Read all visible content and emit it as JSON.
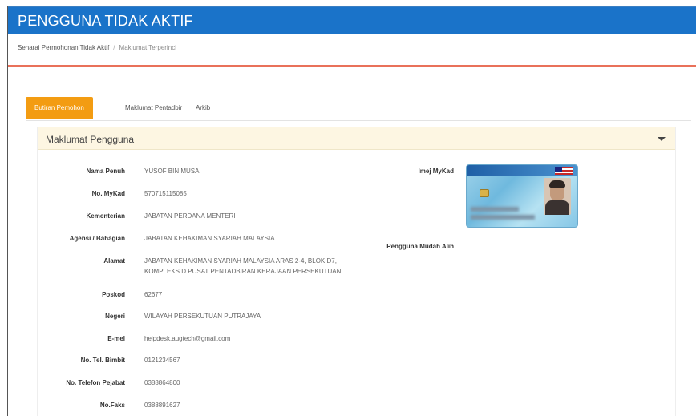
{
  "page": {
    "title": "PENGGUNA TIDAK AKTIF"
  },
  "breadcrumb": {
    "items": [
      "Senarai Permohonan Tidak Aktif",
      "Maklumat Terperinci"
    ],
    "separator": "/"
  },
  "tabs": [
    {
      "label": "Butiran Pemohon",
      "active": true
    },
    {
      "label": "Maklumat Pentadbir",
      "active": false
    },
    {
      "label": "Arkib",
      "active": false
    }
  ],
  "panel": {
    "title": "Maklumat Pengguna",
    "toggle_icon": "caret-down-icon"
  },
  "fields": [
    {
      "label": "Nama Penuh",
      "value": "YUSOF BIN MUSA"
    },
    {
      "label": "No. MyKad",
      "value": "570715115085"
    },
    {
      "label": "Kementerian",
      "value": "JABATAN PERDANA MENTERI"
    },
    {
      "label": "Agensi / Bahagian",
      "value": "JABATAN KEHAKIMAN SYARIAH MALAYSIA"
    },
    {
      "label": "Alamat",
      "value_line1": "JABATAN KEHAKIMAN SYARIAH MALAYSIA ARAS 2-4, BLOK D7,",
      "value_line2": "KOMPLEKS D PUSAT PENTADBIRAN KERAJAAN PERSEKUTUAN"
    },
    {
      "label": "Poskod",
      "value": "62677"
    },
    {
      "label": "Negeri",
      "value": "WILAYAH PERSEKUTUAN PUTRAJAYA"
    },
    {
      "label": "E-mel",
      "value": "helpdesk.augtech@gmail.com"
    },
    {
      "label": "No. Tel. Bimbit",
      "value": "0121234567"
    },
    {
      "label": "No. Telefon Pejabat",
      "value": "0388864800"
    },
    {
      "label": "No.Faks",
      "value": "0388891627"
    }
  ],
  "right_fields": {
    "mykad_image_label": "Imej MyKad",
    "mobile_user_label": "Pengguna Mudah Alih"
  },
  "colors": {
    "header_blue": "#1a73c9",
    "accent_orange": "#f39c12",
    "accent_line": "#e9715a",
    "panel_header_bg": "#fdf6e2"
  }
}
